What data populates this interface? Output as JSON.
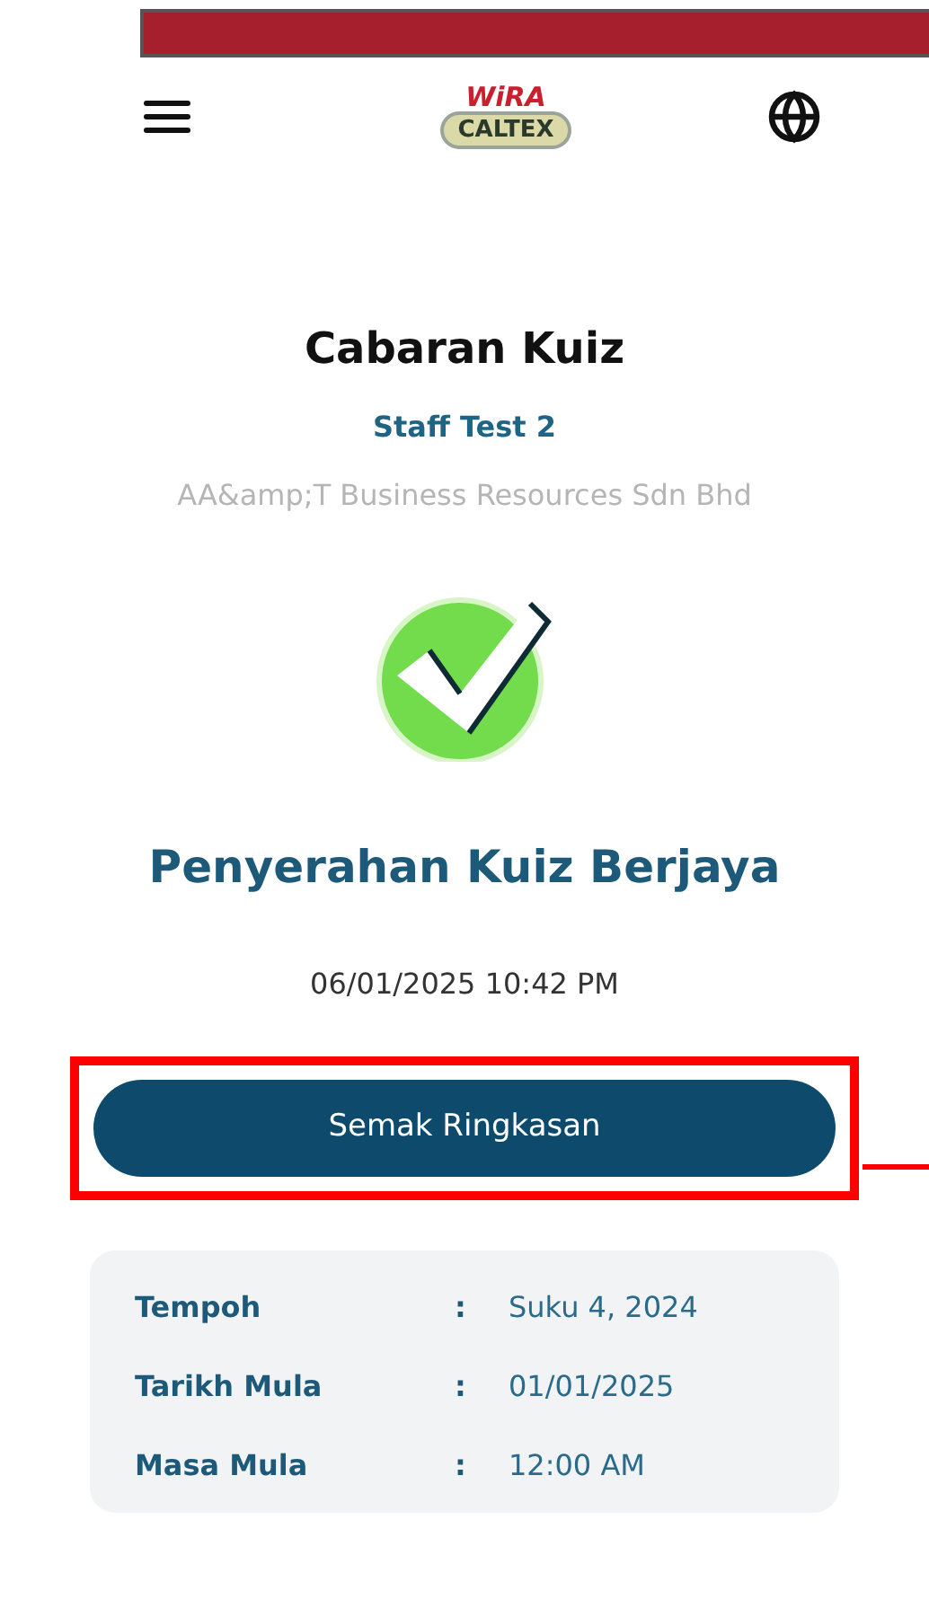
{
  "logo": {
    "line_1": "WiRA",
    "line_2": "CALTEX"
  },
  "title": "Cabaran Kuiz",
  "quiz_name": "Staff Test 2",
  "company": "AA&amp;T Business Resources Sdn Bhd",
  "status": "Penyerahan Kuiz Berjaya",
  "submitted_at": "06/01/2025 10:42 PM",
  "summary_button": {
    "label": "Semak Ringkasan",
    "highlighted": true
  },
  "details": [
    {
      "label": "Tempoh",
      "separator": ":",
      "value": "Suku 4, 2024"
    },
    {
      "label": "Tarikh Mula",
      "separator": ":",
      "value": "01/01/2025"
    },
    {
      "label": "Masa Mula",
      "separator": ":",
      "value": "12:00 AM"
    }
  ]
}
